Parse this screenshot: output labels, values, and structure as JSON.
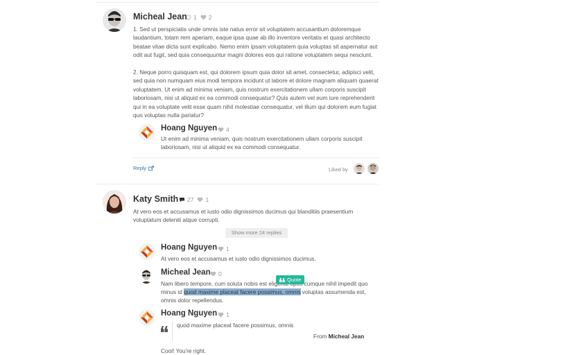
{
  "comments": {
    "c1": {
      "author": "Micheal Jean",
      "reply_count": "1",
      "like_count": "2",
      "p1": "1.  Sed ut perspiciatis unde omnis iste natus error sit voluptatem accusantium doloremque laudantium, totam rem aperiam, eaque ipsa quae ab illo inventore veritatis et quasi architecto beatae vitae dicta sunt explicabo. Nemo enim ipsam voluptatem quia voluptas sit aspernatur aut odit aut fugit, sed quia consequuntur magni dolores eos qui ratione voluptatem sequi nesciunt.",
      "p2": "2.  Neque porro quisquam est, qui dolorem ipsum quia dolor sit amet, consectetur, adipisci velit, sed quia non numquam eius modi tempora incidunt ut labore et dolore magnam aliquam quaerat voluptatem. Ut enim ad minima veniam, quis nostrum exercitationem ullam corporis suscipit laboriosam, nisi ut aliquid ex ea commodi consequatur? Quis autem vel eum iure reprehenderit qui in ea voluptate velit esse quam nihil molestiae consequatur, vel illum qui dolorem eum fugiat quo voluptas nulla pariatur?",
      "nested": {
        "author": "Hoang Nguyen",
        "like_count": "4",
        "text": "Ut enim ad minima veniam, quis nostrum exercitationem ullam corporis suscipit laboriosam, nisi ut aliquid ex ea commodi consequatur."
      },
      "reply_label": "Reply",
      "liked_by_label": "Liked by"
    },
    "c2": {
      "author": "Katy Smith",
      "comment_count": "27",
      "like_count": "1",
      "text": "At vero eos et accusamus et iusto odio dignissimos ducimus qui blanditiis praesentium voluptatum deleniti atque corrupti.",
      "show_more_label": "Show more 24 replies",
      "r1": {
        "author": "Hoang Nguyen",
        "like_count": "1",
        "text": "At vero eos et accusamus et iusto odio dignissimos ducimus."
      },
      "r2": {
        "author": "Micheal Jean",
        "like_count": "0",
        "line1": "Nam libero tempore, cum soluta nobis est eligendi optio cumque nihil impedit quo",
        "line2_pre": "minus id ",
        "line2_hl": "quod maxime placeat facere possimus, omnis",
        "line2_post": " voluptas assumenda est,",
        "line3": "omnis dolor repellendus."
      },
      "quote_popup_label": "Quote",
      "r3": {
        "author": "Hoang Nguyen",
        "like_count": "1",
        "quote_text": "quod maxime placeat facere possimus, omnis",
        "quote_from_prefix": "From",
        "quote_from_author": "Micheal Jean",
        "text": "Cool! You're right."
      }
    }
  },
  "colors": {
    "accent": "#26b99a",
    "link": "#2a7ab0",
    "highlight": "#8ab0d0"
  }
}
